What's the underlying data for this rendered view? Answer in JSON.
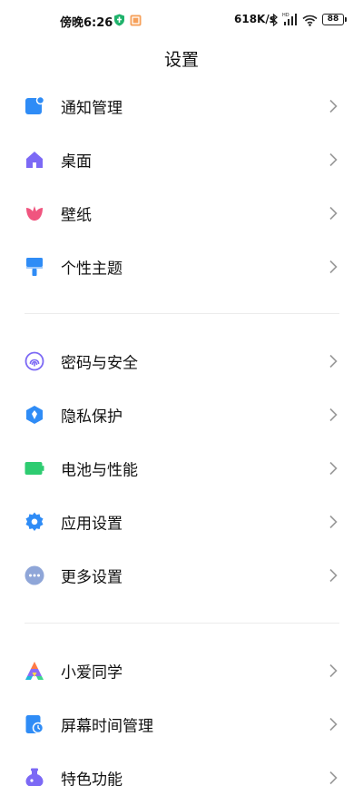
{
  "status_bar": {
    "time": "傍晚6:26",
    "net_speed": "618K/s",
    "battery": "88"
  },
  "header": {
    "title": "设置"
  },
  "sections": [
    {
      "items": [
        {
          "label": "通知管理",
          "icon": "notification-icon",
          "color": "#2f8cf6"
        },
        {
          "label": "桌面",
          "icon": "home-icon",
          "color": "#7c69f5"
        },
        {
          "label": "壁纸",
          "icon": "tulip-icon",
          "color": "#f0557f"
        },
        {
          "label": "个性主题",
          "icon": "paintbrush-icon",
          "color": "#2f8cf6"
        }
      ]
    },
    {
      "items": [
        {
          "label": "密码与安全",
          "icon": "fingerprint-icon",
          "color": "#7c69f5"
        },
        {
          "label": "隐私保护",
          "icon": "privacy-shield-icon",
          "color": "#2f8cf6"
        },
        {
          "label": "电池与性能",
          "icon": "battery-icon",
          "color": "#2ecc71"
        },
        {
          "label": "应用设置",
          "icon": "gear-icon",
          "color": "#2f8cf6"
        },
        {
          "label": "更多设置",
          "icon": "more-dots-icon",
          "color": "#8fa6d8"
        }
      ]
    },
    {
      "items": [
        {
          "label": "小爱同学",
          "icon": "xiaoai-icon",
          "color": "#ff7a45"
        },
        {
          "label": "屏幕时间管理",
          "icon": "screen-time-icon",
          "color": "#2f8cf6"
        },
        {
          "label": "特色功能",
          "icon": "potion-icon",
          "color": "#7c69f5"
        }
      ]
    }
  ]
}
